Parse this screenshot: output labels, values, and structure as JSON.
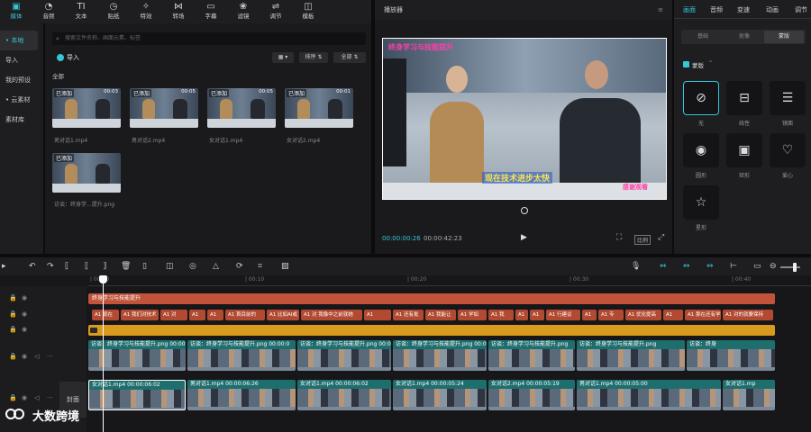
{
  "toolbar": {
    "items": [
      {
        "label": "媒体",
        "icon": "media-icon",
        "active": true
      },
      {
        "label": "音频",
        "icon": "audio-icon"
      },
      {
        "label": "文本",
        "icon": "text-icon"
      },
      {
        "label": "贴纸",
        "icon": "sticker-icon"
      },
      {
        "label": "特效",
        "icon": "effects-icon"
      },
      {
        "label": "转场",
        "icon": "transition-icon"
      },
      {
        "label": "字幕",
        "icon": "subtitle-icon"
      },
      {
        "label": "滤镜",
        "icon": "filter-icon"
      },
      {
        "label": "调节",
        "icon": "adjust-icon"
      },
      {
        "label": "模板",
        "icon": "template-icon"
      }
    ]
  },
  "leftnav": {
    "items": [
      {
        "label": "• 本地",
        "active": true
      },
      {
        "label": "导入"
      },
      {
        "label": "我的预设"
      },
      {
        "label": "• 云素材"
      },
      {
        "label": "素材库"
      }
    ]
  },
  "media": {
    "search_placeholder": "搜索文件名称、画面元素、标签",
    "import_label": "导入",
    "sort_label": "排序",
    "filter_label": "全部",
    "all_label": "全部",
    "items": [
      {
        "tag": "已添加",
        "duration": "00:03",
        "name": "男对话1.mp4"
      },
      {
        "tag": "已添加",
        "duration": "00:05",
        "name": "男对话2.mp4"
      },
      {
        "tag": "已添加",
        "duration": "00:05",
        "name": "女对话1.mp4"
      },
      {
        "tag": "已添加",
        "duration": "00:01",
        "name": "女对话2.mp4"
      },
      {
        "tag": "已添加",
        "duration": "",
        "name": "访谈：终身学...提升.png"
      }
    ]
  },
  "player": {
    "title": "播放器",
    "video_title": "终身学习与技能提升",
    "caption": "现在技术进步太快",
    "sticker": "感谢观看",
    "current_time": "00:00:00:26",
    "total_time": "00:00:42:23",
    "ratio_label": "比例"
  },
  "right": {
    "tabs": [
      "画面",
      "音频",
      "变速",
      "动画",
      "调节"
    ],
    "active_tab": "画面",
    "subtabs": [
      "基础",
      "抠像",
      "蒙版"
    ],
    "active_subtab": "蒙版",
    "mask_label": "蒙版",
    "masks": [
      {
        "label": "无",
        "icon": "none-icon"
      },
      {
        "label": "线性",
        "icon": "linear-mask-icon"
      },
      {
        "label": "镜面",
        "icon": "mirror-mask-icon"
      },
      {
        "label": "圆形",
        "icon": "circle-mask-icon"
      },
      {
        "label": "矩形",
        "icon": "rect-mask-icon"
      },
      {
        "label": "爱心",
        "icon": "heart-mask-icon"
      },
      {
        "label": "星形",
        "icon": "star-mask-icon"
      }
    ]
  },
  "timeline": {
    "ruler": [
      "| 00:00",
      "| 00:10",
      "| 00:20",
      "| 00:30",
      "| 00:40"
    ],
    "title_clip": "终身学习与技能提升",
    "text_clips": [
      "A1 现在",
      "A1 我们对技术",
      "A1 对",
      "A1",
      "A1",
      "A1 首目前的",
      "A1 比如AI或",
      "A1 对 我像中之前就她",
      "A1",
      "A1 还有批",
      "A1 我能让",
      "A1 学如",
      "A1 我",
      "A1",
      "A1",
      "A1 行建议",
      "A1",
      "A1 专",
      "A1 优化提高",
      "A1",
      "A1 那在还有学习",
      "A1 对的就要保持"
    ],
    "overlay_clips": [
      "访谈：终身学习与技能提升.png  00:00:0",
      "访谈：终身学习与技能提升.png  00:00:0",
      "访谈：终身学习与技能提升.png  00:00:0",
      "访谈：终身学习与技能提升.png  00:00:0",
      "访谈：终身学习与技能提升.png",
      "访谈：终身学习与技能提升.png",
      "访谈：终身"
    ],
    "main_clips": [
      "女对话1.mp4  00:00:06:02",
      "男对话1.mp4  00:00:06:26",
      "女对话1.mp4  00:00:06:02",
      "女对话1.mp4  00:00:05:24",
      "女对话2.mp4  00:00:05:19",
      "男对话1.mp4  00:00:05:00",
      "女对话1.mp"
    ],
    "cover_label": "封面"
  },
  "watermark": "大数跨境"
}
